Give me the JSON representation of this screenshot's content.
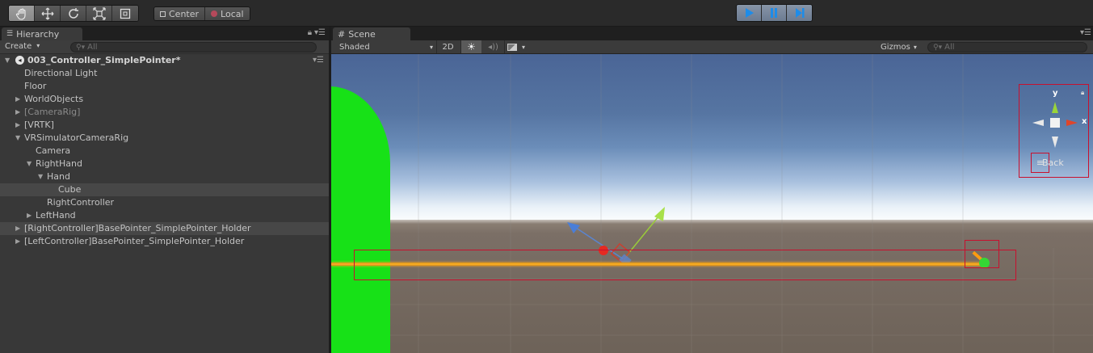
{
  "toolbar": {
    "tools": [
      {
        "icon": "hand-icon",
        "active": true
      },
      {
        "icon": "move-icon",
        "active": false
      },
      {
        "icon": "rotate-icon",
        "active": false
      },
      {
        "icon": "scale-icon",
        "active": false
      },
      {
        "icon": "rect-transform-icon",
        "active": false
      }
    ],
    "pivot": {
      "center_label": "Center",
      "local_label": "Local"
    },
    "playback": {
      "play_icon": "play-icon",
      "pause_icon": "pause-icon",
      "step_icon": "step-icon"
    }
  },
  "hierarchy": {
    "tab_label": "Hierarchy",
    "create_label": "Create",
    "search_placeholder": "All",
    "scene_name": "003_Controller_SimplePointer*",
    "items": [
      {
        "label": "Directional Light",
        "depth": 1,
        "fold": "",
        "state": "normal"
      },
      {
        "label": "Floor",
        "depth": 1,
        "fold": "",
        "state": "normal"
      },
      {
        "label": "WorldObjects",
        "depth": 1,
        "fold": "collapsed",
        "state": "normal"
      },
      {
        "label": "[CameraRig]",
        "depth": 1,
        "fold": "collapsed",
        "state": "disabled"
      },
      {
        "label": "[VRTK]",
        "depth": 1,
        "fold": "collapsed",
        "state": "normal"
      },
      {
        "label": "VRSimulatorCameraRig",
        "depth": 1,
        "fold": "expanded",
        "state": "normal"
      },
      {
        "label": "Camera",
        "depth": 2,
        "fold": "",
        "state": "normal"
      },
      {
        "label": "RightHand",
        "depth": 2,
        "fold": "expanded",
        "state": "normal"
      },
      {
        "label": "Hand",
        "depth": 3,
        "fold": "expanded",
        "state": "normal"
      },
      {
        "label": "Cube",
        "depth": 4,
        "fold": "",
        "state": "selected"
      },
      {
        "label": "RightController",
        "depth": 3,
        "fold": "",
        "state": "normal"
      },
      {
        "label": "LeftHand",
        "depth": 2,
        "fold": "collapsed",
        "state": "normal"
      },
      {
        "label": "[RightController]BasePointer_SimplePointer_Holder",
        "depth": 1,
        "fold": "collapsed",
        "state": "selected"
      },
      {
        "label": "[LeftController]BasePointer_SimplePointer_Holder",
        "depth": 1,
        "fold": "collapsed",
        "state": "normal"
      }
    ]
  },
  "scene": {
    "tab_label": "Scene",
    "shading_mode": "Shaded",
    "mode_2d_label": "2D",
    "gizmos_label": "Gizmos",
    "search_placeholder": "All",
    "orientation": {
      "y_label": "y",
      "x_label": "x",
      "view_label": "Back",
      "colors": {
        "y": "#9ad43a",
        "x": "#e0452a",
        "neutral": "#e8e8e8"
      }
    }
  },
  "colors": {
    "highlight_box": "#c8102e",
    "pointer_beam": "#ffb42a",
    "pointer_tip": "#35d735",
    "green_object": "#17e117",
    "play_accent": "#1e8ce8"
  }
}
